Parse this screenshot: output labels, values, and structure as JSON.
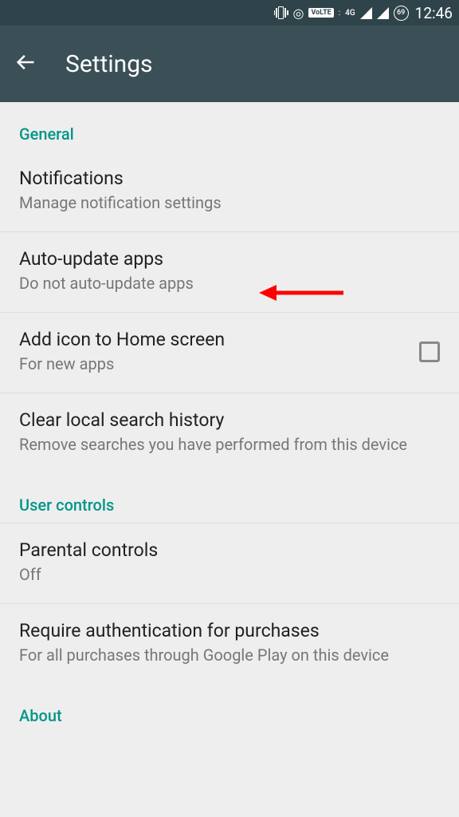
{
  "status": {
    "volte_label": "VoLTE",
    "net_label": "4G",
    "battery_pct": "69",
    "time": "12:46"
  },
  "header": {
    "title": "Settings"
  },
  "sections": {
    "general": {
      "label": "General",
      "notifications": {
        "title": "Notifications",
        "subtitle": "Manage notification settings"
      },
      "auto_update": {
        "title": "Auto-update apps",
        "subtitle": "Do not auto-update apps"
      },
      "add_icon": {
        "title": "Add icon to Home screen",
        "subtitle": "For new apps"
      },
      "clear_search": {
        "title": "Clear local search history",
        "subtitle": "Remove searches you have performed from this device"
      }
    },
    "user_controls": {
      "label": "User controls",
      "parental": {
        "title": "Parental controls",
        "subtitle": "Off"
      },
      "auth": {
        "title": "Require authentication for purchases",
        "subtitle": "For all purchases through Google Play on this device"
      }
    },
    "about": {
      "label": "About"
    }
  }
}
